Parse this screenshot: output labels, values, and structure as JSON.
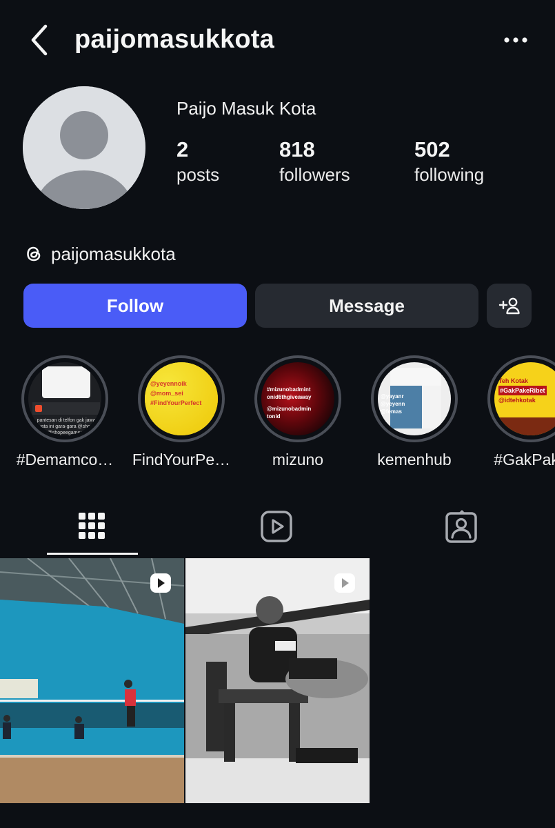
{
  "header": {
    "username": "paijomasukkota",
    "back_icon": "chevron-left-icon",
    "more_icon": "more-horizontal-icon"
  },
  "profile": {
    "display_name": "Paijo Masuk Kota",
    "stats": {
      "posts_count": "2",
      "posts_label": "posts",
      "followers_count": "818",
      "followers_label": "followers",
      "following_count": "502",
      "following_label": "following"
    },
    "threads_handle": "paijomasukkota",
    "threads_icon": "threads-icon"
  },
  "actions": {
    "follow_label": "Follow",
    "message_label": "Message",
    "suggest_icon": "add-person-icon"
  },
  "highlights": [
    {
      "label": "#Demamco…",
      "cover_text": [
        "pantesan di telfon gak jawab",
        "ternyata ini gara-gara @shopee_id",
        "@shopeegames.id"
      ]
    },
    {
      "label": "FindYourPe…",
      "cover_text": [
        "@yeyennoik",
        "@mom_sei",
        "#FindYourPerfect"
      ]
    },
    {
      "label": "mizuno",
      "cover_text": [
        "#mizunobadmint",
        "onid6thgiveaway",
        "@mizunobadmin",
        "tonid"
      ]
    },
    {
      "label": "kemenhub",
      "cover_text": [
        "@yayanr",
        "@yeyenn",
        "@femas"
      ]
    },
    {
      "label": "#GakPake",
      "cover_text": [
        "Teh Kotak",
        "#GakPakeRibet",
        "@idtehkotak"
      ]
    }
  ],
  "tabs": [
    {
      "name": "posts-grid",
      "icon": "grid-icon",
      "active": true
    },
    {
      "name": "reels",
      "icon": "reels-icon",
      "active": false
    },
    {
      "name": "tagged",
      "icon": "tagged-person-icon",
      "active": false
    }
  ],
  "posts": [
    {
      "type": "reel",
      "description_icon": "reel-badge-icon"
    },
    {
      "type": "reel",
      "description_icon": "reel-badge-icon"
    }
  ],
  "colors": {
    "background": "#0c0f14",
    "follow_button": "#4a5cf7",
    "secondary_button": "#262a31",
    "highlight_ring": "#4a4e57"
  }
}
